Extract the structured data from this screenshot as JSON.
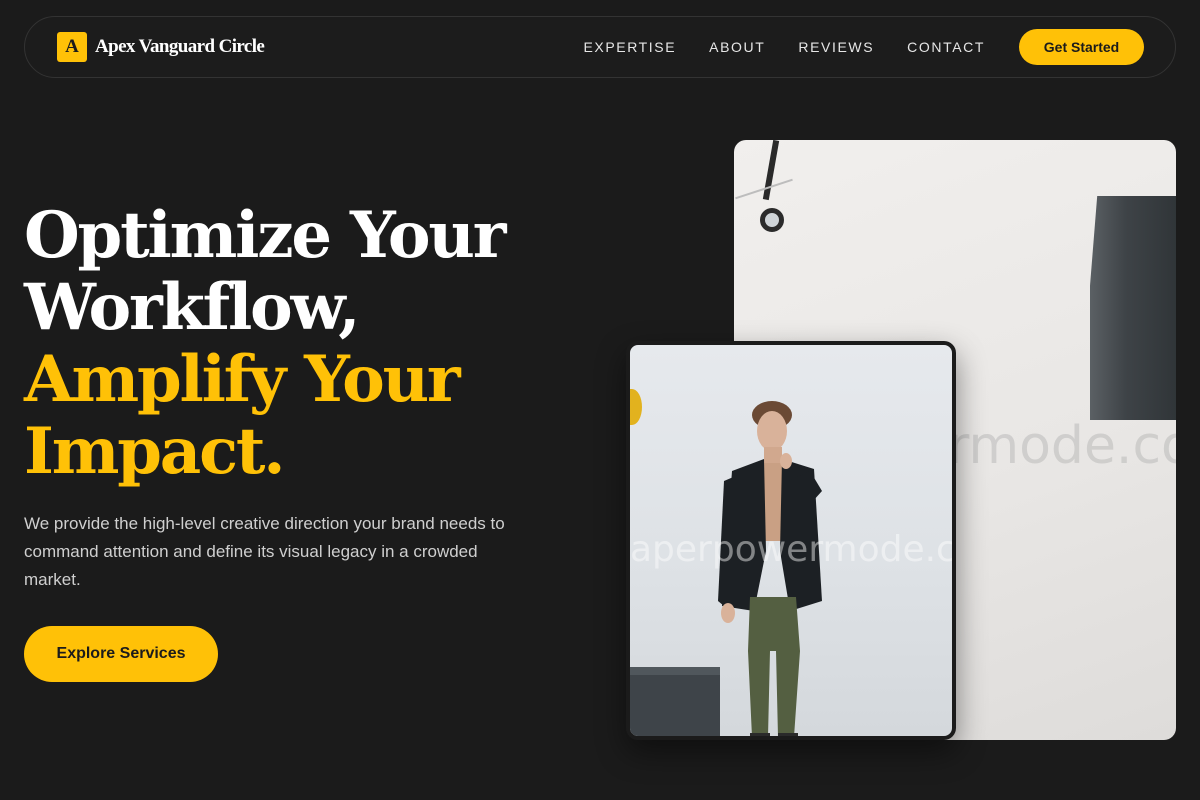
{
  "brand": {
    "mark": "A",
    "name": "Apex Vanguard Circle"
  },
  "nav": {
    "links": [
      "EXPERTISE",
      "ABOUT",
      "REVIEWS",
      "CONTACT"
    ],
    "cta": "Get Started"
  },
  "hero": {
    "title_line1": "Optimize Your",
    "title_line2": "Workflow,",
    "title_line3": "Amplify Your",
    "title_line4": "Impact.",
    "description": "We provide the high-level creative direction your brand needs to command attention and define its visual legacy in a crowded market.",
    "cta": "Explore Services"
  },
  "images": {
    "back_watermark": "rmode.co",
    "front_watermark": "aperpowermode.co"
  },
  "colors": {
    "background": "#1b1b1b",
    "accent": "#ffc107",
    "text": "#ffffff",
    "muted_text": "#cfcfcf"
  }
}
